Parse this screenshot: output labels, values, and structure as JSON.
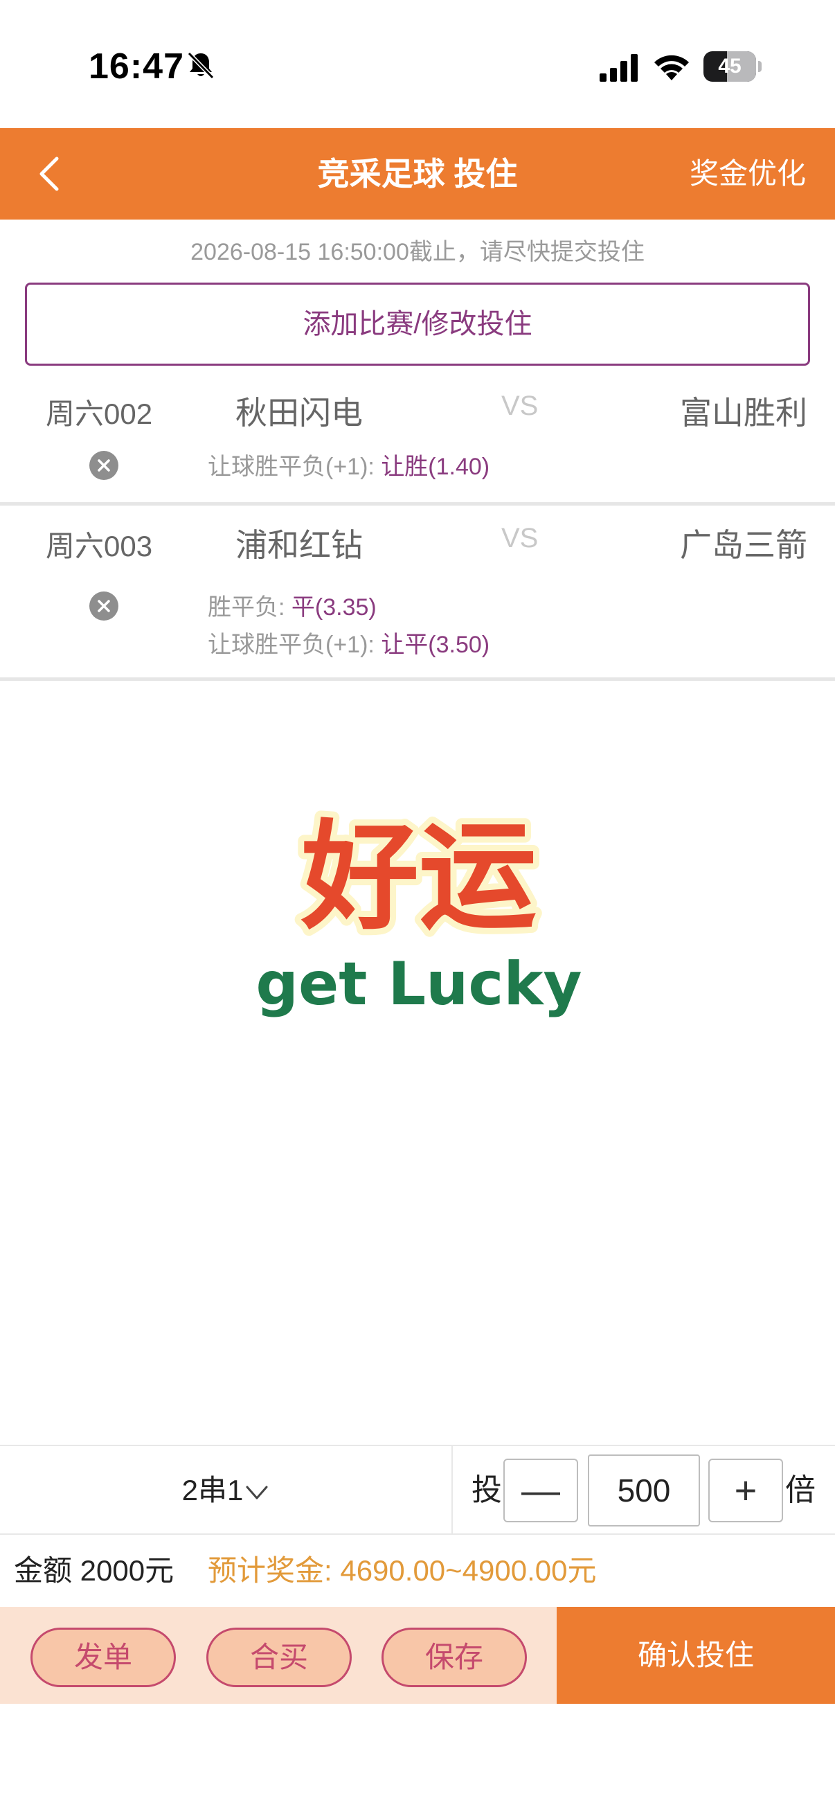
{
  "status_bar": {
    "time": "16:47",
    "battery": "45",
    "icons": [
      "bell-slash-icon",
      "cellular-signal-icon",
      "wifi-icon",
      "battery-icon"
    ]
  },
  "header": {
    "back_icon": "chevron-left-icon",
    "title": "竞采足球 投住",
    "right_action": "奖金优化",
    "color": "#ed7c30"
  },
  "deadline_text": "2026-08-15 16:50:00截止，请尽快提交投住",
  "add_match_button": "添加比赛/修改投住",
  "matches": [
    {
      "code": "周六002",
      "home": "秋田闪电",
      "vs": "VS",
      "away": "富山胜利",
      "bets": [
        {
          "label": "让球胜平负(+1): ",
          "value": "让胜(1.40)"
        }
      ]
    },
    {
      "code": "周六003",
      "home": "浦和红钻",
      "vs": "VS",
      "away": "广岛三箭",
      "bets": [
        {
          "label": "胜平负: ",
          "value": "平(3.35)"
        },
        {
          "label": "让球胜平负(+1): ",
          "value": "让平(3.50)"
        }
      ]
    }
  ],
  "lucky_image": {
    "main": "好运",
    "sub": "get Lucky"
  },
  "bet_bar": {
    "pass_type": "2串1",
    "tou_label": "投",
    "minus_label": "—",
    "multiplier": "500",
    "plus_label": "+",
    "bei_label": "倍"
  },
  "amount_row": {
    "amount": "金额 2000元",
    "prize": "预计奖金: 4690.00~4900.00元"
  },
  "actions": {
    "send": "发单",
    "group_buy": "合买",
    "save": "保存",
    "confirm": "确认投住"
  },
  "colors": {
    "accent": "#ed7c30",
    "purple": "#8a3b7f",
    "prize": "#e29a3a",
    "pill_border": "#c54a6d"
  }
}
